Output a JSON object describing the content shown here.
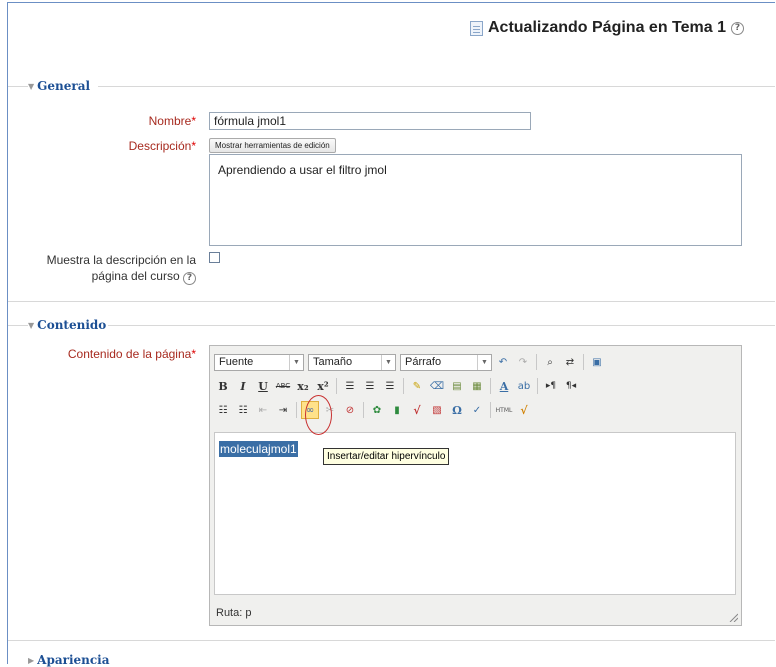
{
  "header": {
    "title": "Actualizando Página en Tema 1"
  },
  "sections": {
    "general": "General",
    "contenido": "Contenido",
    "apariencia": "Apariencia"
  },
  "form": {
    "nombre_label": "Nombre",
    "nombre_value": "fórmula jmol1",
    "descripcion_label": "Descripción",
    "toggle_editor_label": "Mostrar herramientas de edición",
    "descripcion_value": "Aprendiendo a usar el filtro jmol",
    "mostrar_label_1": "Muestra la descripción en la",
    "mostrar_label_2": "página del curso",
    "mostrar_checked": false,
    "contenido_label": "Contenido de la página",
    "required_mark": "*"
  },
  "editor": {
    "font_select": "Fuente",
    "size_select": "Tamaño",
    "format_select": "Párrafo",
    "content_text": "moleculajmol1",
    "tooltip": "Insertar/editar hipervínculo",
    "path_label": "Ruta: p"
  },
  "icons": {
    "bold": "B",
    "italic": "I",
    "underline": "U",
    "strike": "ABC",
    "subscript": "x₂",
    "superscript": "x²",
    "omega": "Ω",
    "html": "HTML"
  },
  "colors": {
    "accent": "#1c4f94",
    "label_red": "#a72a1f",
    "selection": "#3a6ea5"
  }
}
